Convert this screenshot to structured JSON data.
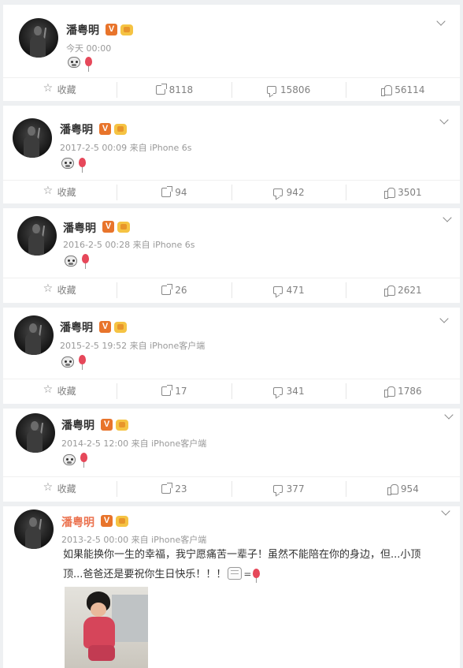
{
  "posts": [
    {
      "name": "潘粤明",
      "meta": "今天 00:00",
      "actions": {
        "favorite": "收藏",
        "forward": "8118",
        "comment": "15806",
        "like": "56114"
      }
    },
    {
      "name": "潘粤明",
      "meta": "2017-2-5 00:09 来自 iPhone 6s",
      "actions": {
        "favorite": "收藏",
        "forward": "94",
        "comment": "942",
        "like": "3501"
      }
    },
    {
      "name": "潘粤明",
      "meta": "2016-2-5 00:28 来自 iPhone 6s",
      "actions": {
        "favorite": "收藏",
        "forward": "26",
        "comment": "471",
        "like": "2621"
      }
    },
    {
      "name": "潘粤明",
      "meta": "2015-2-5 19:52 来自 iPhone客户端",
      "actions": {
        "favorite": "收藏",
        "forward": "17",
        "comment": "341",
        "like": "1786"
      }
    },
    {
      "name": "潘粤明",
      "meta": "2014-2-5 12:00 来自 iPhone客户端",
      "actions": {
        "favorite": "收藏",
        "forward": "23",
        "comment": "377",
        "like": "954"
      }
    },
    {
      "name": "潘粤明",
      "meta": "2013-2-5 00:00 来自 iPhone客户端",
      "text_line1": "如果能换你一生的幸福，我宁愿痛苦一辈子！虽然不能陪在你的身边，但...小顶",
      "text_line2": "顶...爸爸还是要祝你生日快乐！！！"
    }
  ],
  "badges": {
    "verified": "V"
  },
  "icons": [
    "avatar",
    "verified-badge-icon",
    "vip-crown-icon",
    "emoji-icon",
    "balloon-icon",
    "chevron-down-icon",
    "star-icon",
    "forward-icon",
    "comment-icon",
    "like-icon",
    "cake-icon"
  ],
  "colors": {
    "page_bg": "#eef0f2",
    "card_bg": "#ffffff",
    "verified_orange": "#e8742b",
    "username_orange": "#eb7350",
    "meta_gray": "#999999",
    "action_gray": "#808080"
  }
}
